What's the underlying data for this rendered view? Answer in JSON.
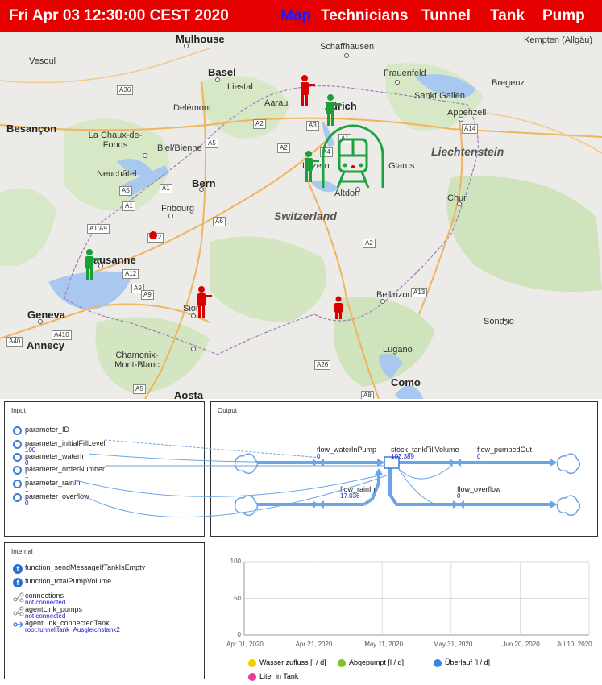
{
  "header": {
    "datetime": "Fri Apr 03 12:30:00 CEST 2020",
    "tabs": [
      "Map",
      "Technicians",
      "Tunnel",
      "Tank",
      "Pump"
    ],
    "active_tab": "Map"
  },
  "map": {
    "places": [
      "Mulhouse",
      "Basel",
      "Liestal",
      "Delémont",
      "Aarau",
      "Zürich",
      "Schaffhausen",
      "Frauenfeld",
      "Kempten (Allgäu)",
      "Bregenz",
      "Sankt Gallen",
      "Appenzell",
      "Vesoul",
      "Besançon",
      "La Chaux-de-Fonds",
      "Biel/Bienne",
      "Neuchâtel",
      "Bern",
      "Luzern",
      "Glarus",
      "Liechtenstein",
      "Chur",
      "Altdorf",
      "Fribourg",
      "Switzerland",
      "Lausanne",
      "Geneva",
      "Sion",
      "Bellinzona",
      "Lugano",
      "Sondrio",
      "Chamonix-Mont-Blanc",
      "Annecy",
      "Aosta",
      "Como"
    ],
    "roads": [
      "A36",
      "A2",
      "A3",
      "A1",
      "A5",
      "A14",
      "A2",
      "A5",
      "A1",
      "A1",
      "A12",
      "A6",
      "A1;A9",
      "A12",
      "A9",
      "A9",
      "A40",
      "A410",
      "A13",
      "A26",
      "A5",
      "A8",
      "A4",
      "A2"
    ]
  },
  "input_panel": {
    "title": "Input",
    "params": [
      {
        "name": "parameter_ID",
        "value": "1"
      },
      {
        "name": "parameter_initialFillLevel",
        "value": "100"
      },
      {
        "name": "parameter_waterIn",
        "value": "0"
      },
      {
        "name": "parameter_orderNumber",
        "value": "1"
      },
      {
        "name": "parameter_rainIn",
        "value": "1"
      },
      {
        "name": "parameter_overflow",
        "value": "0"
      }
    ]
  },
  "output_panel": {
    "title": "Output",
    "flows": [
      {
        "name": "flow_waterInPump",
        "value": "0"
      },
      {
        "name": "stock_tankFillVolume",
        "value": "103.389"
      },
      {
        "name": "flow_pumpedOut",
        "value": "0"
      },
      {
        "name": "flow_rainIn",
        "value": "17.036"
      },
      {
        "name": "flow_overflow",
        "value": "0"
      }
    ]
  },
  "internal_panel": {
    "title": "Internal",
    "functions": [
      "function_sendMessageIfTankIsEmpty",
      "function_totalPumpVolume"
    ],
    "links": [
      {
        "name": "connections",
        "value": "not connected"
      },
      {
        "name": "agentLink_pumps",
        "value": "not connected"
      },
      {
        "name": "agentLink_connectedTank",
        "value": "root.tunnel.tank_Ausgleichstank2"
      }
    ]
  },
  "chart_data": {
    "type": "line",
    "title": "",
    "x_ticks": [
      "Apr 01, 2020",
      "Apr 21, 2020",
      "May 11, 2020",
      "May 31, 2020",
      "Jun 20, 2020",
      "Jul 10, 2020"
    ],
    "y_ticks": [
      "100",
      "50",
      "0"
    ],
    "ylim": [
      0,
      100
    ],
    "grid": true,
    "series": [
      {
        "name": "Wasser zufluss [l / d]",
        "color": "#f5d000",
        "values": []
      },
      {
        "name": "Abgepumpt [l / d]",
        "color": "#7cc22b",
        "values": []
      },
      {
        "name": "Überlauf [l / d]",
        "color": "#2e8ae6",
        "values": []
      },
      {
        "name": "Liter in Tank",
        "color": "#e83e9a",
        "values": []
      }
    ]
  }
}
